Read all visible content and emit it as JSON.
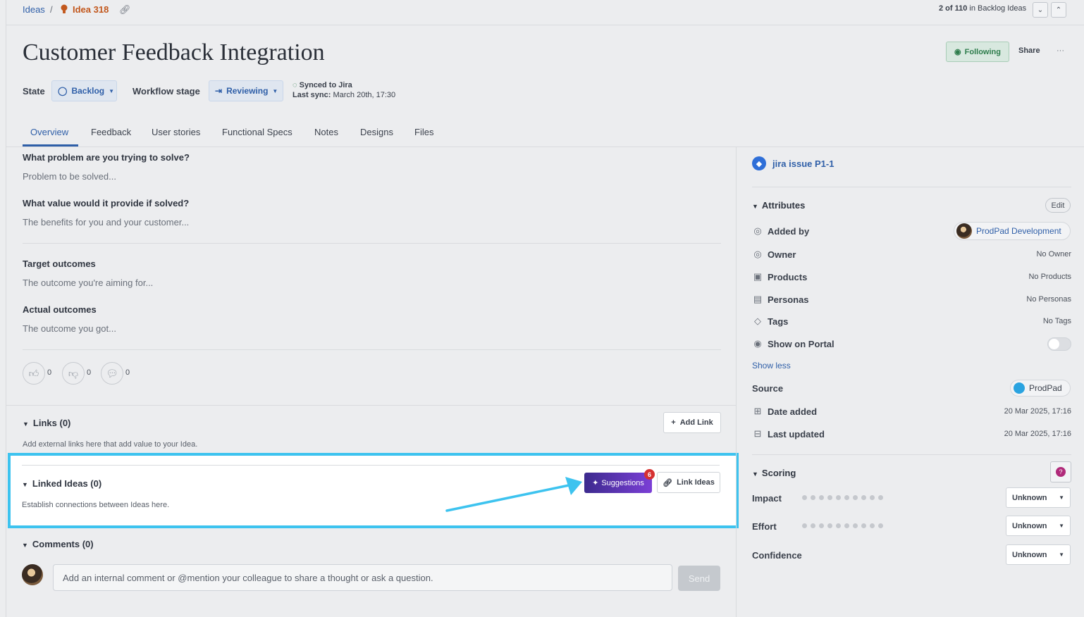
{
  "breadcrumb": {
    "root": "Ideas",
    "separator": "/",
    "current": "Idea 318"
  },
  "pagination": {
    "position": "2 of 110",
    "context": "in Backlog Ideas"
  },
  "header": {
    "title": "Customer Feedback Integration",
    "following_label": "Following",
    "share_label": "Share",
    "more_label": "···"
  },
  "state": {
    "label": "State",
    "value": "Backlog"
  },
  "workflow": {
    "label": "Workflow stage",
    "value": "Reviewing"
  },
  "sync": {
    "status": "Synced to Jira",
    "last_sync_label": "Last sync:",
    "last_sync_value": "March 20th, 17:30"
  },
  "tabs": [
    "Overview",
    "Feedback",
    "User stories",
    "Functional Specs",
    "Notes",
    "Designs",
    "Files"
  ],
  "overview": {
    "q1": "What problem are you trying to solve?",
    "a1": "Problem to be solved...",
    "q2": "What value would it provide if solved?",
    "a2": "The benefits for you and your customer...",
    "q3": "Target outcomes",
    "a3": "The outcome you're aiming for...",
    "q4": "Actual outcomes",
    "a4": "The outcome you got..."
  },
  "votes": {
    "up": "0",
    "down": "0",
    "comments": "0"
  },
  "links": {
    "title": "Links (0)",
    "help": "Add external links here that add value to your Idea.",
    "add_label": "Add Link"
  },
  "linked_ideas": {
    "title": "Linked Ideas (0)",
    "help": "Establish connections between Ideas here.",
    "suggestions_label": "Suggestions",
    "suggestions_count": "6",
    "link_label": "Link Ideas"
  },
  "comments": {
    "title": "Comments (0)",
    "placeholder": "Add an internal comment or @mention your colleague to share a thought or ask a question.",
    "send_label": "Send"
  },
  "sidebar": {
    "jira_label": "jira issue P1-1",
    "attributes_title": "Attributes",
    "edit_label": "Edit",
    "added_by_label": "Added by",
    "added_by_value": "ProdPad Development",
    "owner_label": "Owner",
    "owner_value": "No Owner",
    "products_label": "Products",
    "products_value": "No Products",
    "personas_label": "Personas",
    "personas_value": "No Personas",
    "tags_label": "Tags",
    "tags_value": "No Tags",
    "portal_label": "Show on Portal",
    "show_less": "Show less",
    "source_label": "Source",
    "source_value": "ProdPad",
    "date_added_label": "Date added",
    "date_added_value": "20 Mar 2025, 17:16",
    "last_updated_label": "Last updated",
    "last_updated_value": "20 Mar 2025, 17:16",
    "scoring_title": "Scoring",
    "impact_label": "Impact",
    "impact_value": "Unknown",
    "effort_label": "Effort",
    "effort_value": "Unknown",
    "confidence_label": "Confidence",
    "confidence_value": "Unknown"
  },
  "colors": {
    "accent": "#2f5fa8",
    "highlight": "#3dc3ef",
    "suggestions_start": "#3c2a8e",
    "suggestions_end": "#7b3fd6",
    "badge": "#d63131"
  }
}
